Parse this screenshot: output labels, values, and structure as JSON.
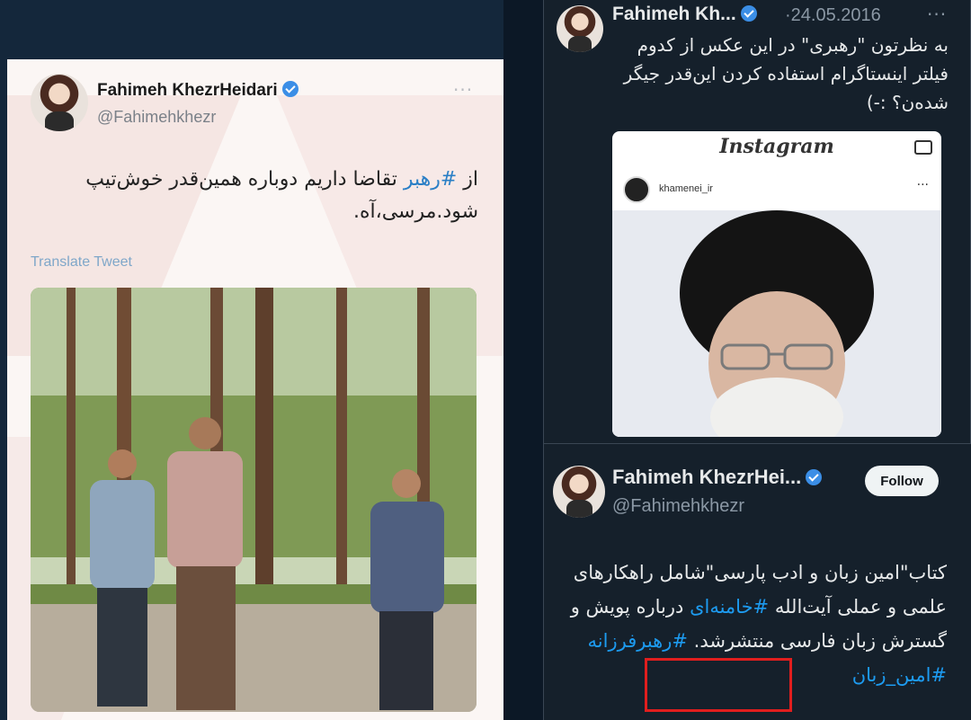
{
  "left_tweet": {
    "name": "Fahimeh KhezrHeidari",
    "handle": "@Fahimehkhezr",
    "text_parts": [
      "از ",
      "#رهبر",
      " تقاضا داریم دوباره همین‌قدر خوش‌تیپ شود.مرسی،آه."
    ],
    "translate_label": "Translate Tweet",
    "more": "···"
  },
  "top_right_tweet": {
    "name": "Fahimeh Kh...",
    "date": "·24.05.2016",
    "more": "···",
    "text": "به نظرتون \"رهبری\" در این عکس از کدوم فیلتر اینستاگرام استفاده کردن این‌قدر جیگر شده‌ن؟ :-)",
    "embed": {
      "logo": "Instagram",
      "username": "khamenei_ir",
      "more": "···"
    }
  },
  "bottom_right_tweet": {
    "name": "Fahimeh KhezrHei...",
    "handle": "@Fahimehkhezr",
    "follow_label": "Follow",
    "text_parts": [
      "کتاب\"امین زبان و ادب پارسی\"شامل راهکارهای علمی و عملی آیت‌الله ",
      "#خامنه‌ای",
      " درباره پویش و گسترش زبان فارسی منتشرشد. ",
      "#رهبرفرزانه",
      " ",
      "#امین_زبان"
    ]
  },
  "colors": {
    "link": "#1d9bf0",
    "verified": "#3b8ee6",
    "dark_bg": "#15202b",
    "highlight_box": "#e01e1e"
  }
}
